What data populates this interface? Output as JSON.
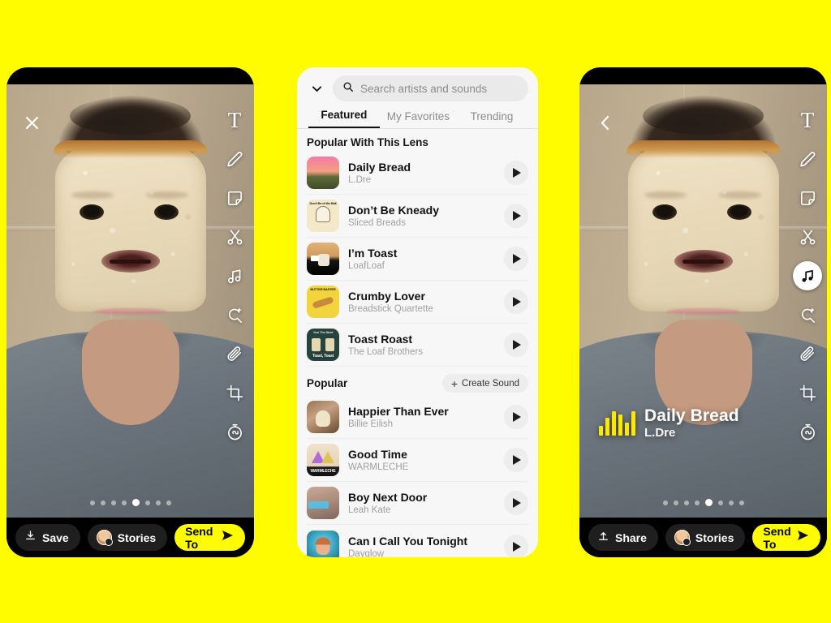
{
  "app": {
    "background_color": "#FFFC00",
    "accent_color": "#FFFC00"
  },
  "left_phone": {
    "close_icon": "close-icon",
    "tools": [
      {
        "name": "text-tool",
        "glyph": "T"
      },
      {
        "name": "draw-tool",
        "glyph": "pencil"
      },
      {
        "name": "sticker-tool",
        "glyph": "sticker"
      },
      {
        "name": "scissors-tool",
        "glyph": "scissors"
      },
      {
        "name": "music-tool",
        "glyph": "music-note"
      },
      {
        "name": "magic-eraser-tool",
        "glyph": "magic-wand"
      },
      {
        "name": "attachment-tool",
        "glyph": "paperclip"
      },
      {
        "name": "crop-tool",
        "glyph": "crop"
      },
      {
        "name": "timer-tool",
        "glyph": "stopwatch"
      }
    ],
    "active_tool_index": -1,
    "carousel": {
      "count": 8,
      "active_index": 4
    },
    "actions": {
      "save_label": "Save",
      "save_icon": "download-icon",
      "stories_label": "Stories",
      "stories_icon": "bitmoji-avatar-icon",
      "send_label": "Send To",
      "send_icon": "send-arrow-icon"
    }
  },
  "right_phone": {
    "back_icon": "chevron-left-icon",
    "tools": [
      {
        "name": "text-tool",
        "glyph": "T"
      },
      {
        "name": "draw-tool",
        "glyph": "pencil"
      },
      {
        "name": "sticker-tool",
        "glyph": "sticker"
      },
      {
        "name": "scissors-tool",
        "glyph": "scissors"
      },
      {
        "name": "music-tool",
        "glyph": "music-note"
      },
      {
        "name": "magic-eraser-tool",
        "glyph": "magic-wand"
      },
      {
        "name": "attachment-tool",
        "glyph": "paperclip"
      },
      {
        "name": "crop-tool",
        "glyph": "crop"
      },
      {
        "name": "timer-tool",
        "glyph": "stopwatch"
      }
    ],
    "active_tool_index": 4,
    "music_sticker": {
      "title": "Daily Bread",
      "artist": "L.Dre",
      "eq_color": "#FFE800",
      "eq_bars": [
        12,
        22,
        30,
        26,
        16,
        30
      ]
    },
    "carousel": {
      "count": 8,
      "active_index": 4
    },
    "actions": {
      "share_label": "Share",
      "share_icon": "upload-icon",
      "stories_label": "Stories",
      "stories_icon": "bitmoji-avatar-icon",
      "send_label": "Send To",
      "send_icon": "send-arrow-icon"
    }
  },
  "music_panel": {
    "collapse_icon": "chevron-down-icon",
    "search": {
      "icon": "search-icon",
      "placeholder": "Search artists and sounds",
      "value": ""
    },
    "tabs": [
      {
        "label": "Featured",
        "active": true
      },
      {
        "label": "My Favorites",
        "active": false
      },
      {
        "label": "Trending",
        "active": false
      }
    ],
    "sections": [
      {
        "title": "Popular With This Lens",
        "action": null,
        "tracks": [
          {
            "title": "Daily Bread",
            "artist": "L.Dre",
            "art_color_a": "#F27BA8",
            "art_color_b": "#6E5A3C",
            "art_top": "",
            "art_caption": "",
            "play_icon": "play-icon"
          },
          {
            "title": "Don’t Be Kneady",
            "artist": "Sliced Breads",
            "art_color_a": "#F3E9C9",
            "art_color_b": "#EADFB8",
            "art_top": "Don’t Be of the Ball",
            "art_caption": "",
            "play_icon": "play-icon"
          },
          {
            "title": "I’m Toast",
            "artist": "LoafLoaf",
            "art_color_a": "#D8A86A",
            "art_color_b": "#121212",
            "art_top": "",
            "art_caption": "",
            "play_icon": "play-icon"
          },
          {
            "title": "Crumby Lover",
            "artist": "Breadstick Quartette",
            "art_color_a": "#F2D43C",
            "art_color_b": "#E8C52E",
            "art_top": "BUTTER BASTER",
            "art_caption": "",
            "play_icon": "play-icon"
          },
          {
            "title": "Toast Roast",
            "artist": "The Loaf Brothers",
            "art_color_a": "#2C4A47",
            "art_color_b": "#1B332F",
            "art_top": "Yes! The Steel",
            "art_caption": "Toast, Toast",
            "play_icon": "play-icon"
          }
        ]
      },
      {
        "title": "Popular",
        "action": {
          "label": "Create Sound",
          "icon": "plus-icon"
        },
        "tracks": [
          {
            "title": "Happier Than Ever",
            "artist": "Billie Eilish",
            "art_color_a": "#B98D64",
            "art_color_b": "#6E4B31",
            "art_top": "",
            "art_caption": "",
            "play_icon": "play-icon"
          },
          {
            "title": "Good Time",
            "artist": "WARMLECHE",
            "art_color_a": "#C8A7E8",
            "art_color_b": "#F0E0C8",
            "art_top": "",
            "art_caption": "WARMLECHE",
            "play_icon": "play-icon"
          },
          {
            "title": "Boy Next Door",
            "artist": "Leah Kate",
            "art_color_a": "#C9A99B",
            "art_color_b": "#8E7A6B",
            "art_top": "",
            "art_caption": "",
            "play_icon": "play-icon"
          },
          {
            "title": "Can I Call You Tonight",
            "artist": "Dayglow",
            "art_color_a": "#3FA8C4",
            "art_color_b": "#1C6A86",
            "art_top": "",
            "art_caption": "",
            "play_icon": "play-icon"
          }
        ]
      }
    ]
  }
}
